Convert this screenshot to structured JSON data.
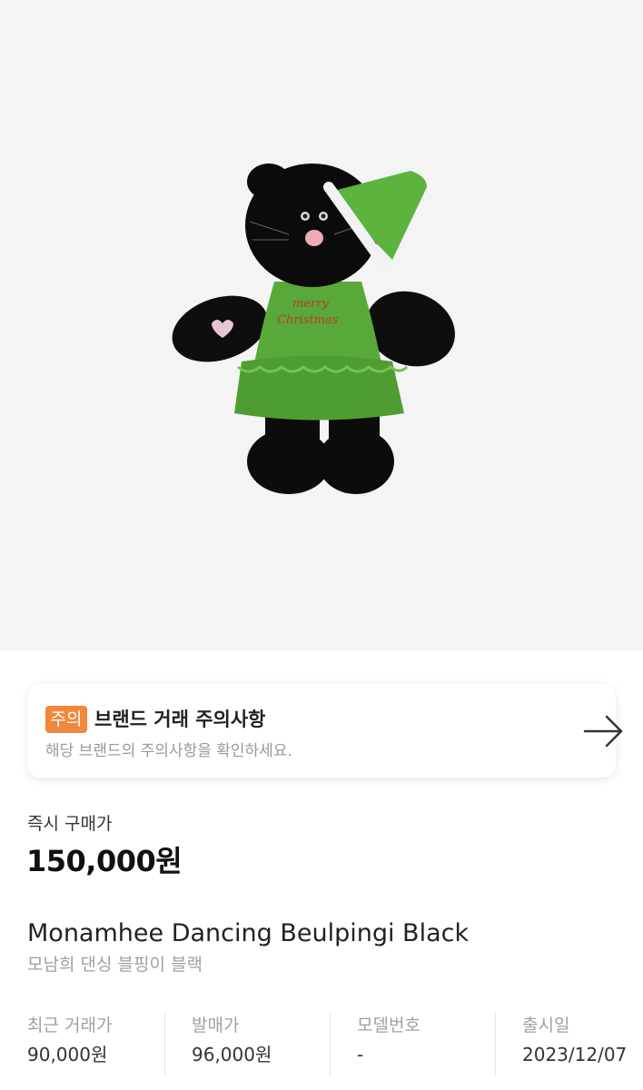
{
  "notice": {
    "badge": "주의",
    "title": "브랜드 거래 주의사항",
    "description": "해당 브랜드의 주의사항을 확인하세요.",
    "badge_color": "#f0883e"
  },
  "product_image": {
    "embroidery_line1": "merry",
    "embroidery_line2": "Christmas"
  },
  "price": {
    "label": "즉시 구매가",
    "value": "150,000원"
  },
  "product": {
    "name_en": "Monamhee Dancing Beulpingi Black",
    "name_ko": "모남희 댄싱 블핑이 블랙"
  },
  "details": [
    {
      "label": "최근 거래가",
      "value": "90,000원"
    },
    {
      "label": "발매가",
      "value": "96,000원"
    },
    {
      "label": "모델번호",
      "value": "-"
    },
    {
      "label": "출시일",
      "value": "2023/12/07"
    }
  ],
  "icons": {
    "arrow": "arrow-right-icon"
  }
}
